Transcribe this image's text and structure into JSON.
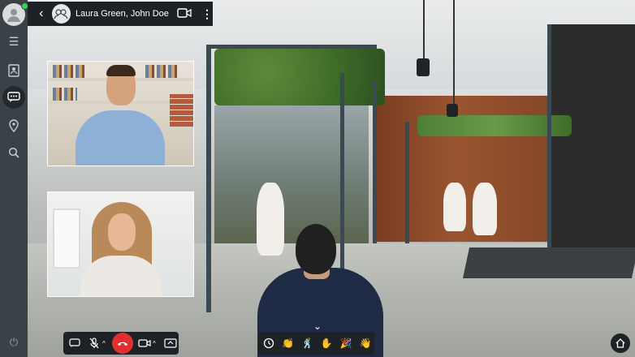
{
  "chat": {
    "title": "Laura Green, John Doe..."
  },
  "sidebar": {
    "items": [
      {
        "icon": "menu-icon"
      },
      {
        "icon": "contacts-icon"
      },
      {
        "icon": "chat-icon",
        "active": true
      },
      {
        "icon": "location-pin-icon"
      },
      {
        "icon": "search-icon"
      }
    ]
  },
  "call_controls": [
    "chat-icon",
    "mute-mic-icon",
    "hang-up-icon",
    "camera-icon",
    "screen-share-icon"
  ],
  "gestures": [
    "clock-icon",
    "clap-icon",
    "dance-icon",
    "raise-hand-icon",
    "celebrate-icon",
    "wave-icon"
  ],
  "colors": {
    "hang_up": "#e0302d",
    "online": "#39d353",
    "bar_bg": "#1e2226"
  }
}
